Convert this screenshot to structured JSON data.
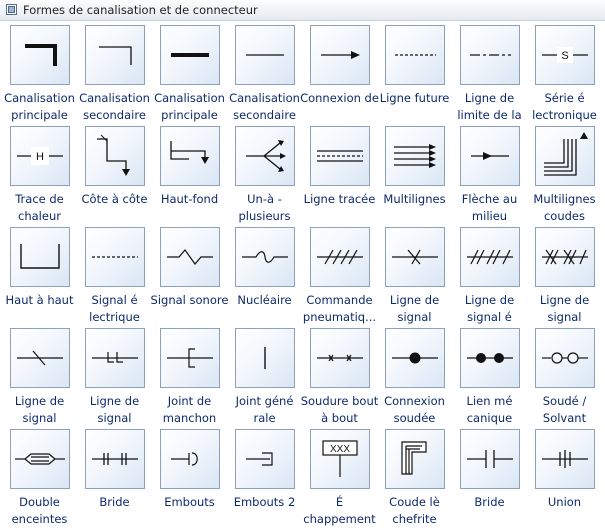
{
  "panel": {
    "title": "Formes de canalisation et de connecteur",
    "items": [
      {
        "label": "Canalisation principale",
        "icon": "main-pipe-corner-icon"
      },
      {
        "label": "Canalisation secondaire",
        "icon": "secondary-pipe-corner-icon"
      },
      {
        "label": "Canalisation principale",
        "icon": "main-pipe-line-icon"
      },
      {
        "label": "Canalisation secondaire",
        "icon": "secondary-pipe-line-icon"
      },
      {
        "label": "Connexion de",
        "icon": "connection-arrow-icon"
      },
      {
        "label": "Ligne future",
        "icon": "dashed-line-icon"
      },
      {
        "label": "Ligne de limite de la",
        "icon": "limit-line-icon"
      },
      {
        "label": "Série é lectronique",
        "icon": "electronic-series-icon"
      },
      {
        "label": "Trace de chaleur",
        "icon": "heat-trace-icon"
      },
      {
        "label": "Côte à côte",
        "icon": "side-by-side-icon"
      },
      {
        "label": "Haut-fond",
        "icon": "shoal-icon"
      },
      {
        "label": "Un-à -plusieurs",
        "icon": "one-to-many-icon"
      },
      {
        "label": "Ligne tracée",
        "icon": "traced-line-icon"
      },
      {
        "label": "Multilignes",
        "icon": "multilines-icon"
      },
      {
        "label": "Flèche au milieu",
        "icon": "arrow-middle-icon"
      },
      {
        "label": "Multilignes coudes",
        "icon": "multilines-elbow-icon"
      },
      {
        "label": "Haut à haut",
        "icon": "top-to-top-icon"
      },
      {
        "label": "Signal é lectrique",
        "icon": "electric-signal-icon"
      },
      {
        "label": "Signal sonore",
        "icon": "sonic-signal-icon"
      },
      {
        "label": "Nucléaire",
        "icon": "nuclear-signal-icon"
      },
      {
        "label": "Commande pneumatiq...",
        "icon": "pneumatic-control-icon"
      },
      {
        "label": "Ligne de signal",
        "icon": "signal-line-cross-icon"
      },
      {
        "label": "Ligne de signal é",
        "icon": "signal-line-hatch-icon"
      },
      {
        "label": "Ligne de signal",
        "icon": "signal-line-xhatch-icon"
      },
      {
        "label": "Ligne de signal",
        "icon": "signal-line-slash-icon"
      },
      {
        "label": "Ligne de signal",
        "icon": "signal-line-ll-icon"
      },
      {
        "label": "Joint de manchon",
        "icon": "sleeve-joint-icon"
      },
      {
        "label": "Joint géné rale",
        "icon": "general-joint-icon"
      },
      {
        "label": "Soudure bout à bout",
        "icon": "butt-weld-icon"
      },
      {
        "label": "Connexion soudée",
        "icon": "welded-connection-icon"
      },
      {
        "label": "Lien mé canique",
        "icon": "mechanical-link-icon"
      },
      {
        "label": "Soudé / Solvant",
        "icon": "solvent-weld-icon"
      },
      {
        "label": "Double enceintes",
        "icon": "double-containment-icon"
      },
      {
        "label": "Bride",
        "icon": "flange-icon"
      },
      {
        "label": "Embouts",
        "icon": "end-cap-icon"
      },
      {
        "label": "Embouts 2",
        "icon": "end-cap-2-icon"
      },
      {
        "label": "É chappement",
        "icon": "exhaust-icon"
      },
      {
        "label": "Coude lè chefrite",
        "icon": "elbow-icon"
      },
      {
        "label": "Bride",
        "icon": "flange-2-icon"
      },
      {
        "label": "Union",
        "icon": "union-icon"
      }
    ]
  }
}
